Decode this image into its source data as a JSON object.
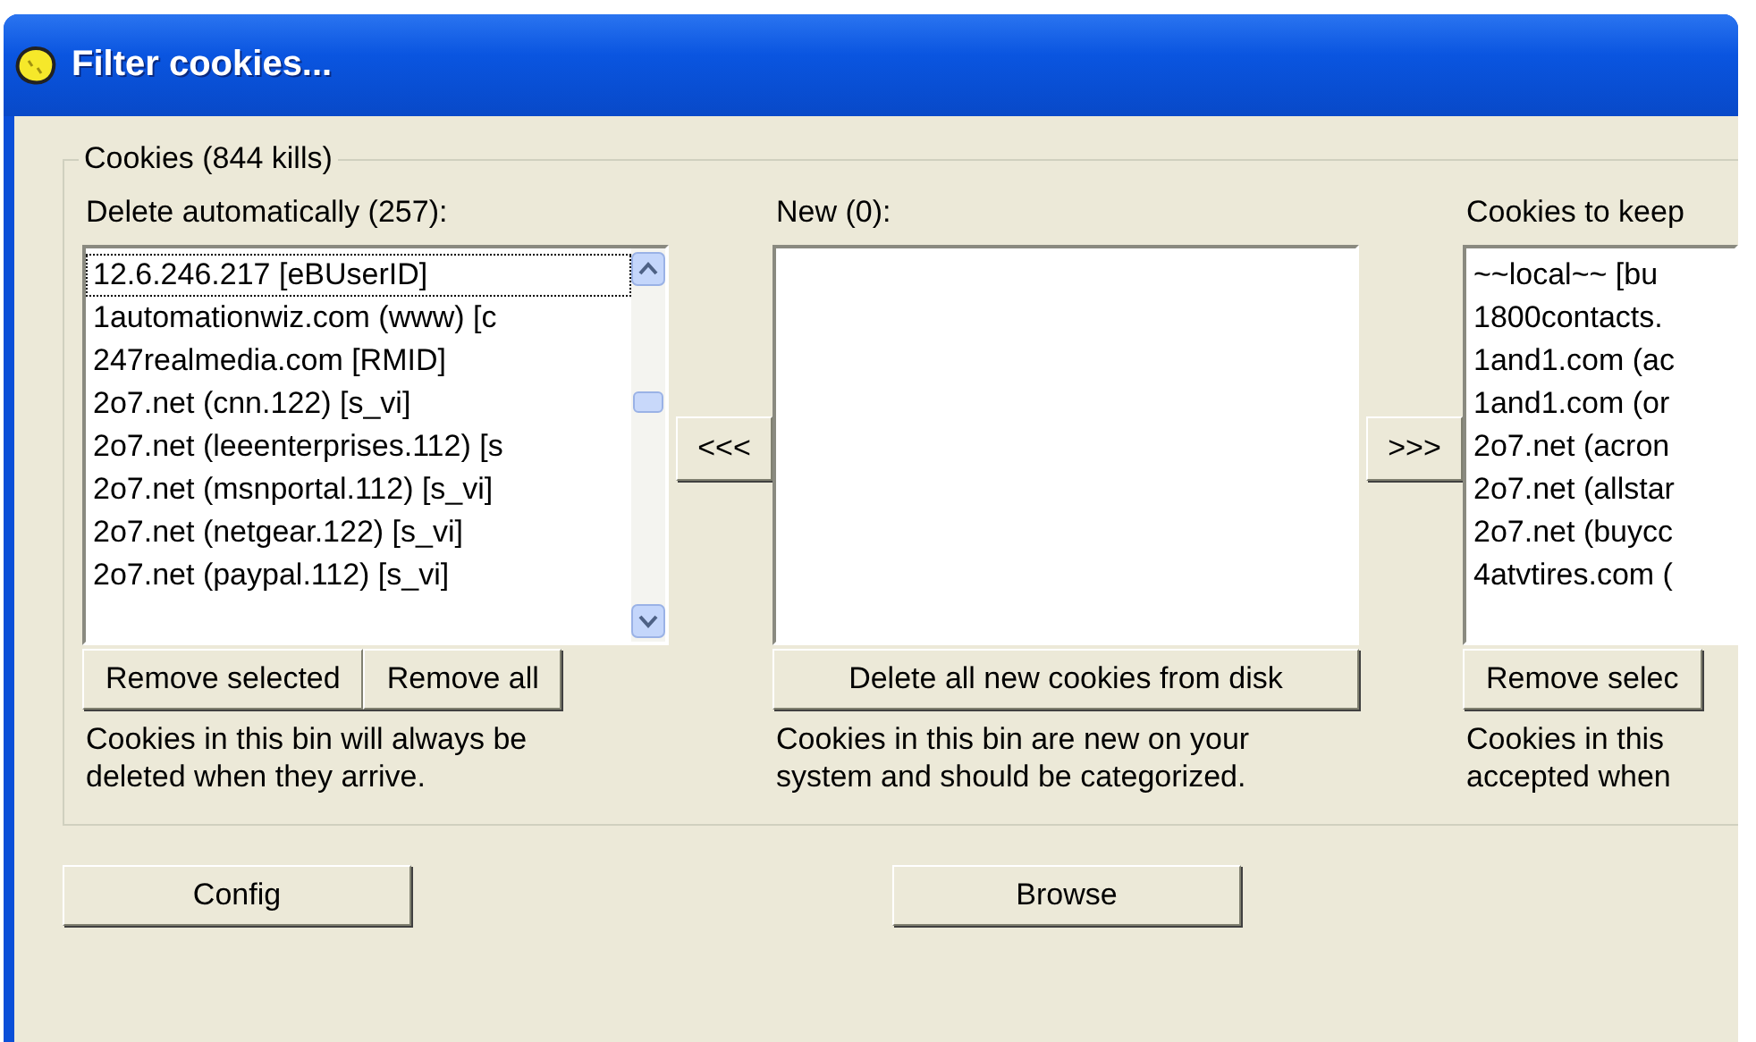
{
  "window": {
    "title": "Filter cookies..."
  },
  "group": {
    "legend": "Cookies (844 kills)",
    "bins": [
      {
        "kind": "list",
        "label": "Delete automatically (257):",
        "scrollbar": true,
        "items": [
          {
            "text": "12.6.246.217 [eBUserID]",
            "focused": true
          },
          {
            "text": "1automationwiz.com (www) [c",
            "focused": false
          },
          {
            "text": "247realmedia.com [RMID]",
            "focused": false
          },
          {
            "text": "2o7.net (cnn.122) [s_vi]",
            "focused": false
          },
          {
            "text": "2o7.net (leeenterprises.112) [s",
            "focused": false
          },
          {
            "text": "2o7.net (msnportal.112) [s_vi]",
            "focused": false
          },
          {
            "text": "2o7.net (netgear.122) [s_vi]",
            "focused": false
          },
          {
            "text": "2o7.net (paypal.112) [s_vi]",
            "focused": false
          }
        ],
        "buttons": [
          "Remove selected",
          "Remove all"
        ],
        "description": [
          "Cookies in this bin will always be",
          "deleted when they arrive."
        ],
        "move_button": "<<<"
      },
      {
        "kind": "list",
        "label": "New (0):",
        "scrollbar": false,
        "buttons": [
          "Delete all new cookies from disk"
        ],
        "description": [
          "Cookies in this bin are new on your",
          "system and should be categorized."
        ],
        "move_button": ">>>"
      },
      {
        "kind": "list",
        "label": "Cookies to keep",
        "scrollbar": false,
        "items": [
          {
            "text": "~~local~~ [bu",
            "focused": false
          },
          {
            "text": "1800contacts.",
            "focused": false
          },
          {
            "text": "1and1.com (ac",
            "focused": false
          },
          {
            "text": "1and1.com (or",
            "focused": false
          },
          {
            "text": "2o7.net (acron",
            "focused": false
          },
          {
            "text": "2o7.net (allstar",
            "focused": false
          },
          {
            "text": "2o7.net (buycc",
            "focused": false
          },
          {
            "text": "4atvtires.com (",
            "focused": false
          }
        ],
        "buttons": [
          "Remove selec"
        ],
        "description": [
          "Cookies in this",
          "accepted when"
        ]
      }
    ]
  },
  "footer_buttons": [
    "Config",
    "Browse"
  ]
}
